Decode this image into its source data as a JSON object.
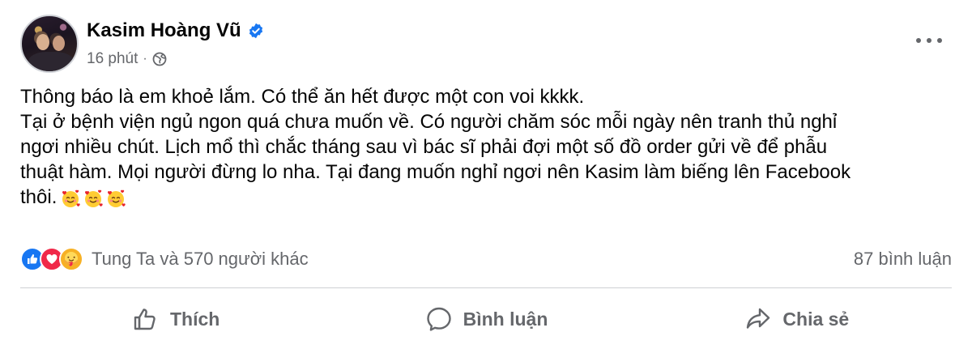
{
  "post": {
    "author": "Kasim Hoàng Vũ",
    "time": "16 phút",
    "separator": "·",
    "body": "Thông báo là em khoẻ lắm. Có thể ăn hết được một con voi kkkk.\nTại ở bệnh viện ngủ ngon quá chưa muốn về. Có người chăm sóc mỗi ngày nên tranh thủ nghỉ\nngơi nhiều chút. Lịch mổ thì chắc tháng sau vì bác sĩ phải đợi một số đồ order gửi về để phẫu\nthuật hàm. Mọi người đừng lo nha. Tại đang muốn nghỉ ngơi nên Kasim làm biếng lên Facebook\nthôi.",
    "emojis": [
      "smiling-face-with-hearts",
      "smiling-face-with-hearts",
      "smiling-face-with-hearts"
    ]
  },
  "stats": {
    "reactions_text": "Tung Ta và 570 người khác",
    "comments_text": "87 bình luận",
    "reaction_types": [
      "like",
      "love",
      "care"
    ]
  },
  "actions": {
    "like": "Thích",
    "comment": "Bình luận",
    "share": "Chia sẻ"
  },
  "colors": {
    "like_blue": "#1877f2",
    "love_red": "#f02849",
    "secondary_text": "#65676b",
    "divider": "#ced0d4"
  }
}
